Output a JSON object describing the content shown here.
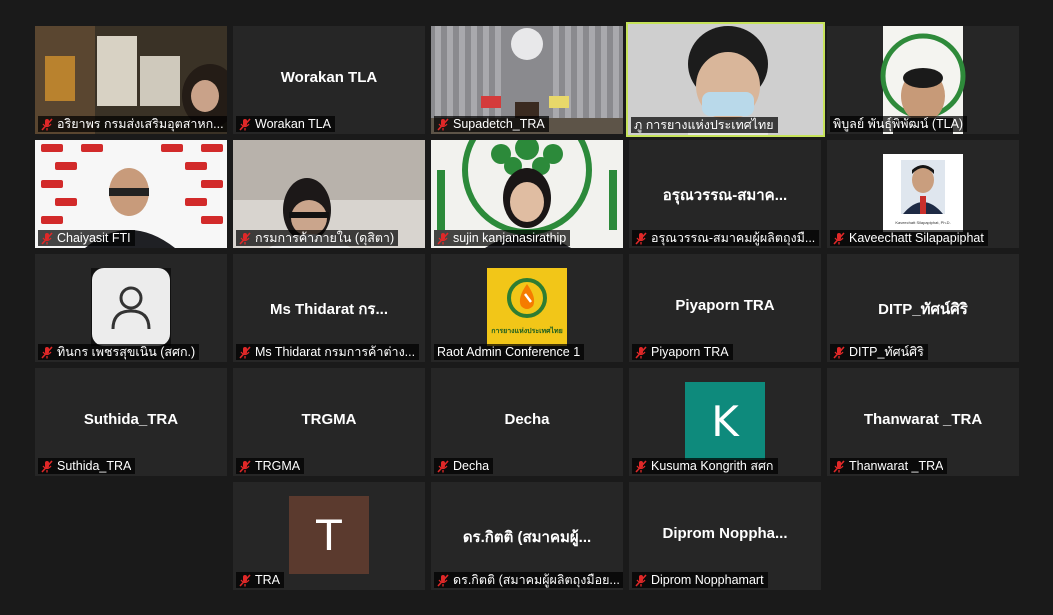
{
  "colors": {
    "background": "#1a1a1a",
    "tile": "#262626",
    "active_speaker_border": "#c6e35a",
    "mute_icon": "#e02828",
    "avatar_k": "#0e8a7c",
    "avatar_t": "#5b3a2e"
  },
  "participants": [
    {
      "name": "อริยาพร กรมส่งเสริมอุตสาหก...",
      "display": "",
      "type": "video"
    },
    {
      "name": "Worakan TLA",
      "display": "Worakan TLA",
      "type": "name"
    },
    {
      "name": "Supadetch_TRA",
      "display": "",
      "type": "video"
    },
    {
      "name": "ภู การยางแห่งประเทศไทย",
      "display": "",
      "type": "video"
    },
    {
      "name": "พิบูลย์ พันธุ์พิพัฒน์ (TLA)",
      "display": "",
      "type": "video"
    },
    {
      "name": "Chaiyasit FTI",
      "display": "",
      "type": "video"
    },
    {
      "name": "กรมการค้าภายใน (ดุสิตา)",
      "display": "",
      "type": "video"
    },
    {
      "name": "sujin kanjanasirathip",
      "display": "",
      "type": "video"
    },
    {
      "name": "อรุณวรรณ-สมาคมผู้ผลิตถุงมื...",
      "display": "อรุณวรรณ-สมาค...",
      "type": "name"
    },
    {
      "name": "Kaveechatt Silapapiphat",
      "display": "",
      "type": "picture",
      "caption": "Kaveechatt Silapapiphat, Ph.D."
    },
    {
      "name": "ทินกร เพชรสุขเนิน (สศก.)",
      "display": "",
      "type": "avatar"
    },
    {
      "name": "Ms Thidarat กรมการค้าต่าง...",
      "display": "Ms  Thidarat กร...",
      "type": "name"
    },
    {
      "name": "Raot Admin Conference 1",
      "display": "",
      "type": "logo",
      "logo_text": "การยางแห่งประเทศไทย"
    },
    {
      "name": "Piyaporn TRA",
      "display": "Piyaporn TRA",
      "type": "name"
    },
    {
      "name": "DITP_ทัศน์ศิริ",
      "display": "DITP_ทัศน์ศิริ",
      "type": "name"
    },
    {
      "name": "Suthida_TRA",
      "display": "Suthida_TRA",
      "type": "name"
    },
    {
      "name": "TRGMA",
      "display": "TRGMA",
      "type": "name"
    },
    {
      "name": "Decha",
      "display": "Decha",
      "type": "name"
    },
    {
      "name": "Kusuma Kongrith สศก",
      "display": "",
      "type": "letter",
      "letter": "K"
    },
    {
      "name": "Thanwarat _TRA",
      "display": "Thanwarat _TRA",
      "type": "name"
    },
    {
      "name": "TRA",
      "display": "",
      "type": "letter",
      "letter": "T"
    },
    {
      "name": "ดร.กิตติ (สมาคมผู้ผลิตถุงมือย...",
      "display": "ดร.กิตติ (สมาคมผู้...",
      "type": "name"
    },
    {
      "name": "Diprom Nopphamart",
      "display": "Diprom  Noppha...",
      "type": "name"
    }
  ]
}
